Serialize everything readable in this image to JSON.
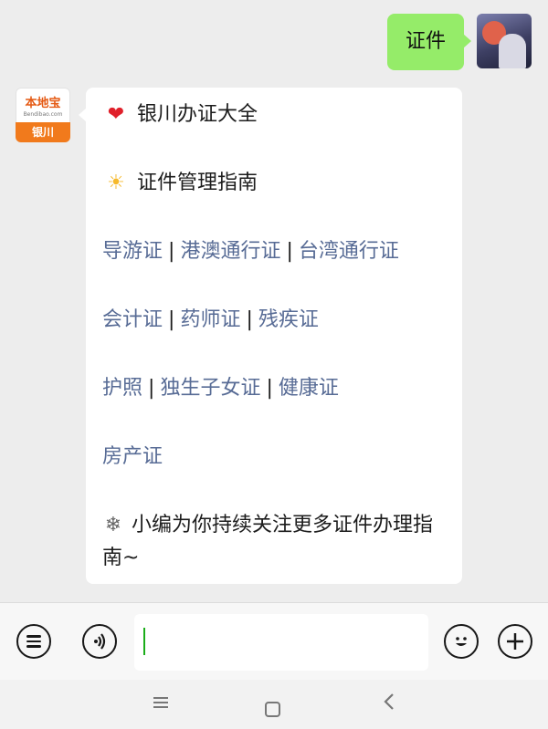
{
  "chat": {
    "outgoing": {
      "text": "证件"
    },
    "incoming": {
      "sender_logo": "本地宝",
      "sender_logo_sub": "Bendibao.com",
      "sender_city": "银川",
      "heading": "银川办证大全",
      "subheading": "证件管理指南",
      "links_row1": [
        "导游证",
        "港澳通行证",
        "台湾通行证"
      ],
      "links_row2": [
        "会计证",
        "药师证",
        "残疾证"
      ],
      "links_row3": [
        "护照",
        "独生子女证",
        "健康证"
      ],
      "links_row4": [
        "房产证"
      ],
      "separator": "|",
      "footer": "小编为你持续关注更多证件办理指南~"
    }
  },
  "input_bar": {
    "icons": [
      "list-icon",
      "voice-icon",
      "emoji-icon",
      "plus-icon"
    ],
    "placeholder": ""
  },
  "nav_bar": {
    "icons": [
      "menu-icon",
      "home-icon",
      "back-icon"
    ]
  },
  "colors": {
    "outgoing_bubble": "#95ec69",
    "link": "#576b95",
    "background": "#ededed"
  }
}
